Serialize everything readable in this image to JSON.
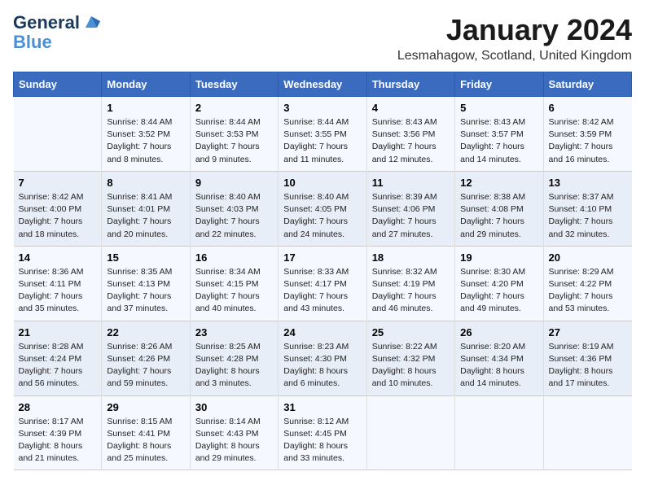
{
  "logo": {
    "line1": "General",
    "line2": "Blue"
  },
  "title": "January 2024",
  "location": "Lesmahagow, Scotland, United Kingdom",
  "headers": [
    "Sunday",
    "Monday",
    "Tuesday",
    "Wednesday",
    "Thursday",
    "Friday",
    "Saturday"
  ],
  "weeks": [
    [
      {
        "day": "",
        "info": ""
      },
      {
        "day": "1",
        "info": "Sunrise: 8:44 AM\nSunset: 3:52 PM\nDaylight: 7 hours\nand 8 minutes."
      },
      {
        "day": "2",
        "info": "Sunrise: 8:44 AM\nSunset: 3:53 PM\nDaylight: 7 hours\nand 9 minutes."
      },
      {
        "day": "3",
        "info": "Sunrise: 8:44 AM\nSunset: 3:55 PM\nDaylight: 7 hours\nand 11 minutes."
      },
      {
        "day": "4",
        "info": "Sunrise: 8:43 AM\nSunset: 3:56 PM\nDaylight: 7 hours\nand 12 minutes."
      },
      {
        "day": "5",
        "info": "Sunrise: 8:43 AM\nSunset: 3:57 PM\nDaylight: 7 hours\nand 14 minutes."
      },
      {
        "day": "6",
        "info": "Sunrise: 8:42 AM\nSunset: 3:59 PM\nDaylight: 7 hours\nand 16 minutes."
      }
    ],
    [
      {
        "day": "7",
        "info": "Sunrise: 8:42 AM\nSunset: 4:00 PM\nDaylight: 7 hours\nand 18 minutes."
      },
      {
        "day": "8",
        "info": "Sunrise: 8:41 AM\nSunset: 4:01 PM\nDaylight: 7 hours\nand 20 minutes."
      },
      {
        "day": "9",
        "info": "Sunrise: 8:40 AM\nSunset: 4:03 PM\nDaylight: 7 hours\nand 22 minutes."
      },
      {
        "day": "10",
        "info": "Sunrise: 8:40 AM\nSunset: 4:05 PM\nDaylight: 7 hours\nand 24 minutes."
      },
      {
        "day": "11",
        "info": "Sunrise: 8:39 AM\nSunset: 4:06 PM\nDaylight: 7 hours\nand 27 minutes."
      },
      {
        "day": "12",
        "info": "Sunrise: 8:38 AM\nSunset: 4:08 PM\nDaylight: 7 hours\nand 29 minutes."
      },
      {
        "day": "13",
        "info": "Sunrise: 8:37 AM\nSunset: 4:10 PM\nDaylight: 7 hours\nand 32 minutes."
      }
    ],
    [
      {
        "day": "14",
        "info": "Sunrise: 8:36 AM\nSunset: 4:11 PM\nDaylight: 7 hours\nand 35 minutes."
      },
      {
        "day": "15",
        "info": "Sunrise: 8:35 AM\nSunset: 4:13 PM\nDaylight: 7 hours\nand 37 minutes."
      },
      {
        "day": "16",
        "info": "Sunrise: 8:34 AM\nSunset: 4:15 PM\nDaylight: 7 hours\nand 40 minutes."
      },
      {
        "day": "17",
        "info": "Sunrise: 8:33 AM\nSunset: 4:17 PM\nDaylight: 7 hours\nand 43 minutes."
      },
      {
        "day": "18",
        "info": "Sunrise: 8:32 AM\nSunset: 4:19 PM\nDaylight: 7 hours\nand 46 minutes."
      },
      {
        "day": "19",
        "info": "Sunrise: 8:30 AM\nSunset: 4:20 PM\nDaylight: 7 hours\nand 49 minutes."
      },
      {
        "day": "20",
        "info": "Sunrise: 8:29 AM\nSunset: 4:22 PM\nDaylight: 7 hours\nand 53 minutes."
      }
    ],
    [
      {
        "day": "21",
        "info": "Sunrise: 8:28 AM\nSunset: 4:24 PM\nDaylight: 7 hours\nand 56 minutes."
      },
      {
        "day": "22",
        "info": "Sunrise: 8:26 AM\nSunset: 4:26 PM\nDaylight: 7 hours\nand 59 minutes."
      },
      {
        "day": "23",
        "info": "Sunrise: 8:25 AM\nSunset: 4:28 PM\nDaylight: 8 hours\nand 3 minutes."
      },
      {
        "day": "24",
        "info": "Sunrise: 8:23 AM\nSunset: 4:30 PM\nDaylight: 8 hours\nand 6 minutes."
      },
      {
        "day": "25",
        "info": "Sunrise: 8:22 AM\nSunset: 4:32 PM\nDaylight: 8 hours\nand 10 minutes."
      },
      {
        "day": "26",
        "info": "Sunrise: 8:20 AM\nSunset: 4:34 PM\nDaylight: 8 hours\nand 14 minutes."
      },
      {
        "day": "27",
        "info": "Sunrise: 8:19 AM\nSunset: 4:36 PM\nDaylight: 8 hours\nand 17 minutes."
      }
    ],
    [
      {
        "day": "28",
        "info": "Sunrise: 8:17 AM\nSunset: 4:39 PM\nDaylight: 8 hours\nand 21 minutes."
      },
      {
        "day": "29",
        "info": "Sunrise: 8:15 AM\nSunset: 4:41 PM\nDaylight: 8 hours\nand 25 minutes."
      },
      {
        "day": "30",
        "info": "Sunrise: 8:14 AM\nSunset: 4:43 PM\nDaylight: 8 hours\nand 29 minutes."
      },
      {
        "day": "31",
        "info": "Sunrise: 8:12 AM\nSunset: 4:45 PM\nDaylight: 8 hours\nand 33 minutes."
      },
      {
        "day": "",
        "info": ""
      },
      {
        "day": "",
        "info": ""
      },
      {
        "day": "",
        "info": ""
      }
    ]
  ]
}
